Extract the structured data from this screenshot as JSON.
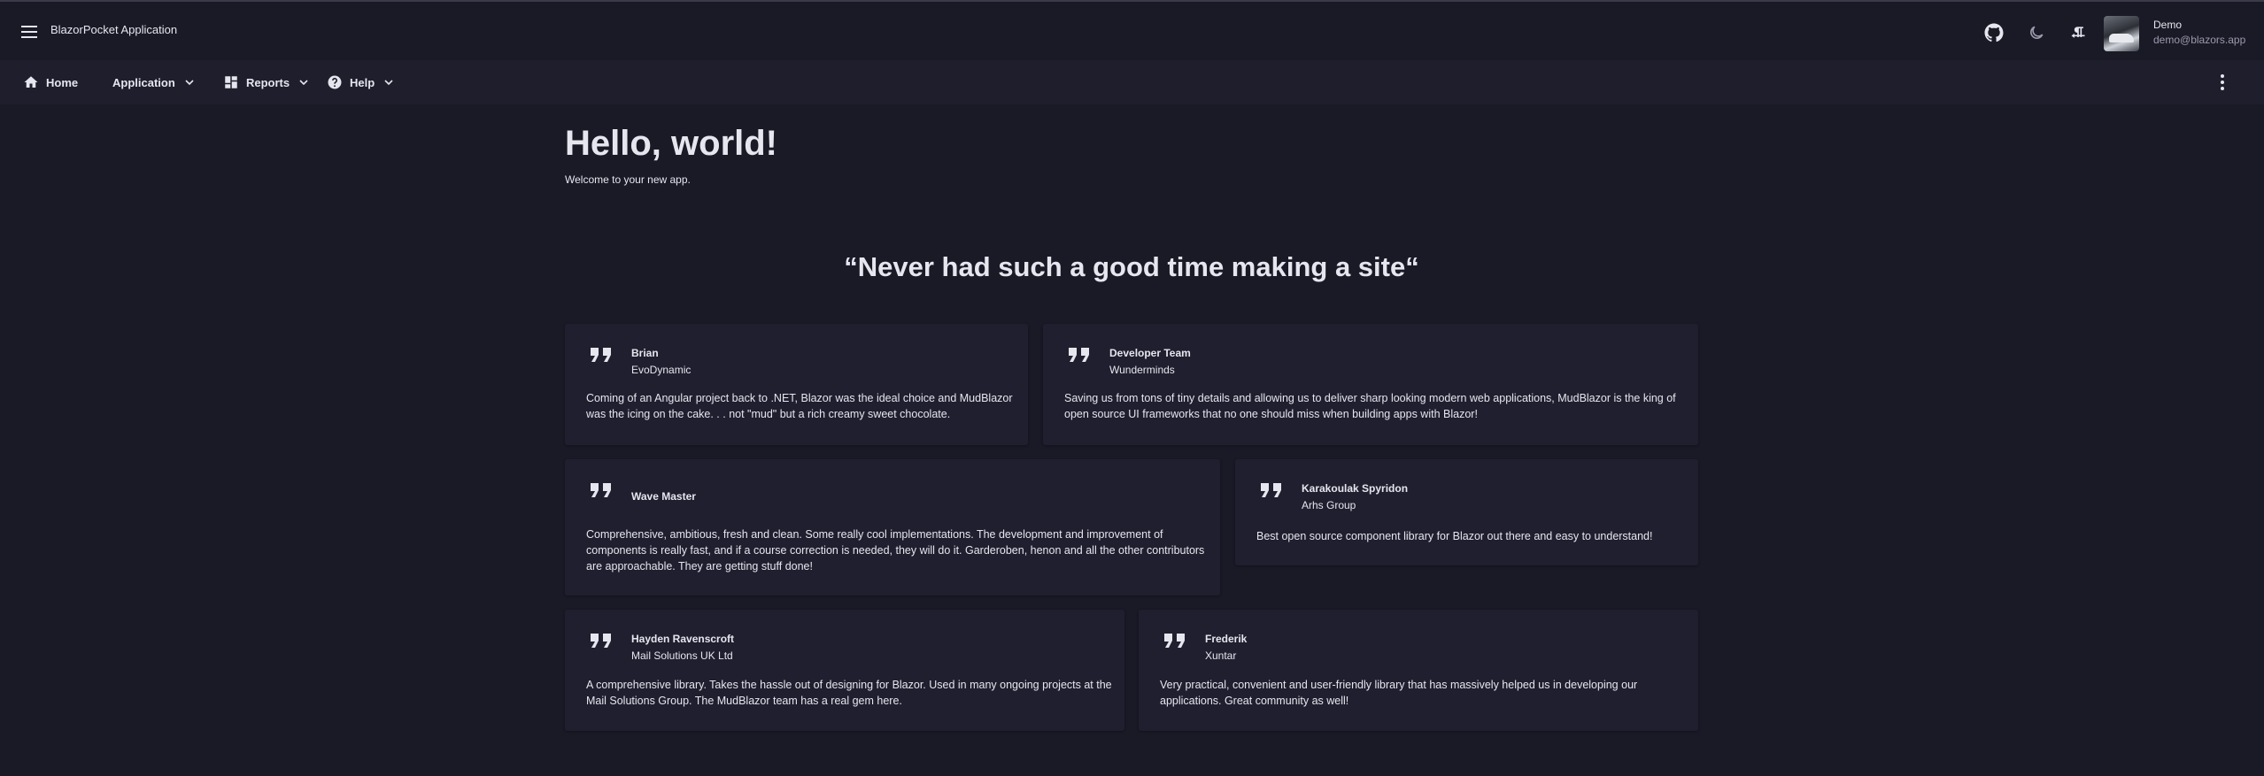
{
  "appbar": {
    "title": "BlazorPocket Application",
    "icons": [
      "menu-icon",
      "github-icon",
      "dark-mode-icon",
      "rtl-icon"
    ],
    "user": {
      "name": "Demo",
      "email": "demo@blazors.app"
    }
  },
  "nav": {
    "items": [
      {
        "label": "Home",
        "icon": "home-icon"
      },
      {
        "label": "Application",
        "icon": ""
      },
      {
        "label": "Reports",
        "icon": "dashboard-icon"
      },
      {
        "label": "Help",
        "icon": "help-icon"
      }
    ]
  },
  "main": {
    "title": "Hello, world!",
    "subtitle": "Welcome to your new app.",
    "headline": "“Never had such a good time making a site“"
  },
  "testimonials": [
    {
      "author": "Brian",
      "company": "EvoDynamic",
      "lines": [
        "Coming of an Angular project back to .NET, Blazor was the ideal choice and MudBlazor",
        "was the icing on the cake. . . not \"mud\" but a rich creamy sweet chocolate."
      ]
    },
    {
      "author": "Developer Team",
      "company": "Wunderminds",
      "lines": [
        "Saving us from tons of tiny details and allowing us to deliver sharp looking modern web applications, MudBlazor is the king of",
        "open source UI frameworks that no one should miss when building apps with Blazor!"
      ]
    },
    {
      "author": "Wave Master",
      "company": "",
      "lines": [
        "Comprehensive, ambitious, fresh and clean. Some really cool implementations. The development and improvement of",
        "components is really fast, and if a course correction is needed, they will do it. Garderoben, henon and all the other contributors",
        "are approachable. They are getting stuff done!"
      ]
    },
    {
      "author": "Karakoulak Spyridon",
      "company": "Arhs Group",
      "lines": [
        "Best open source component library for Blazor out there and easy to understand!"
      ]
    },
    {
      "author": "Hayden Ravenscroft",
      "company": "Mail Solutions UK Ltd",
      "lines": [
        "A comprehensive library. Takes the hassle out of designing for Blazor. Used in many ongoing projects at the",
        "Mail Solutions Group. The MudBlazor team has a real gem here."
      ]
    },
    {
      "author": "Frederik",
      "company": "Xuntar",
      "lines": [
        "Very practical, convenient and user-friendly library that has massively helped us in developing our",
        "applications. Great community as well!"
      ]
    }
  ]
}
